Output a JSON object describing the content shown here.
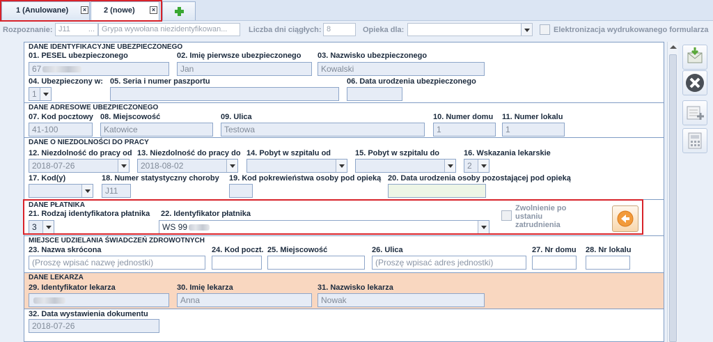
{
  "tabs": [
    {
      "label": "1 (Anulowane)"
    },
    {
      "label": "2 (nowe)"
    }
  ],
  "top": {
    "rozpoznanie_label": "Rozpoznanie:",
    "rozpoznanie_code": "J11",
    "rozpoznanie_text": "Grypa wywołana niezidentyfikowan...",
    "liczba_label": "Liczba dni ciągłych:",
    "liczba_value": "8",
    "opieka_label": "Opieka dla:",
    "elektronizacja_label": "Elektronizacja wydrukowanego formularza"
  },
  "s1": {
    "head": "DANE IDENTYFIKACYJNE UBEZPIECZONEGO",
    "l01": "01. PESEL ubezpieczonego",
    "v01": "67",
    "l02": "02. Imię pierwsze ubezpieczonego",
    "v02": "Jan",
    "l03": "03. Nazwisko ubezpieczonego",
    "v03": "Kowalski",
    "l04": "04. Ubezpieczony w:",
    "v04": "1",
    "l05": "05. Seria i numer paszportu",
    "l06": "06. Data urodzenia ubezpieczonego"
  },
  "s2": {
    "head": "DANE ADRESOWE UBEZPIECZONEGO",
    "l07": "07. Kod pocztowy",
    "v07": "41-100",
    "l08": "08. Miejscowość",
    "v08": "Katowice",
    "l09": "09. Ulica",
    "v09": "Testowa",
    "l10": "10. Numer domu",
    "v10": "1",
    "l11": "11. Numer lokalu",
    "v11": "1"
  },
  "s3": {
    "head": "DANE O NIEZDOLNOŚCI DO PRACY",
    "l12": "12. Niezdolność do pracy od",
    "v12": "2018-07-26",
    "l13": "13. Niezdolność do pracy do",
    "v13": "2018-08-02",
    "l14": "14. Pobyt w szpitalu od",
    "l15": "15. Pobyt w szpitalu do",
    "l16": "16. Wskazania lekarskie",
    "v16": "2",
    "l17": "17. Kod(y)",
    "l18": "18. Numer statystyczny choroby",
    "v18": "J11",
    "l19": "19. Kod pokrewieństwa osoby pod opieką",
    "l20": "20. Data urodzenia osoby pozostającej pod opieką"
  },
  "s4": {
    "head": "DANE PŁATNIKA",
    "l21": "21. Rodzaj identyfikatora płatnika",
    "v21": "3",
    "l22": "22. Identyfikator płatnika",
    "v22": "WS 99",
    "zwolnienie": "Zwolnienie po ustaniu zatrudnienia"
  },
  "s5": {
    "head": "MIEJSCE UDZIELANIA ŚWIADCZEŃ ZDROWOTNYCH",
    "l23": "23. Nazwa skrócona",
    "p23": "(Proszę wpisać nazwę jednostki)",
    "l24": "24. Kod poczt.",
    "l25": "25. Miejscowość",
    "l26": "26. Ulica",
    "p26": "(Proszę wpisać adres jednostki)",
    "l27": "27. Nr domu",
    "l28": "28. Nr lokalu"
  },
  "s6": {
    "head": "DANE LEKARZA",
    "l29": "29. Identyfikator lekarza",
    "l30": "30. Imię lekarza",
    "v30": "Anna",
    "l31": "31. Nazwisko lekarza",
    "v31": "Nowak"
  },
  "s7": {
    "l32": "32. Data wystawienia dokumentu",
    "v32": "2018-07-26"
  },
  "colors": {
    "accent_red": "#d8232a",
    "doctor_bg": "#f9d7c0",
    "form_border": "#7f9cc4"
  },
  "icons": [
    "close-icon",
    "plus-icon",
    "save-envelope-icon",
    "cancel-icon",
    "add-document-icon",
    "calculator-icon",
    "arrow-left-icon"
  ]
}
